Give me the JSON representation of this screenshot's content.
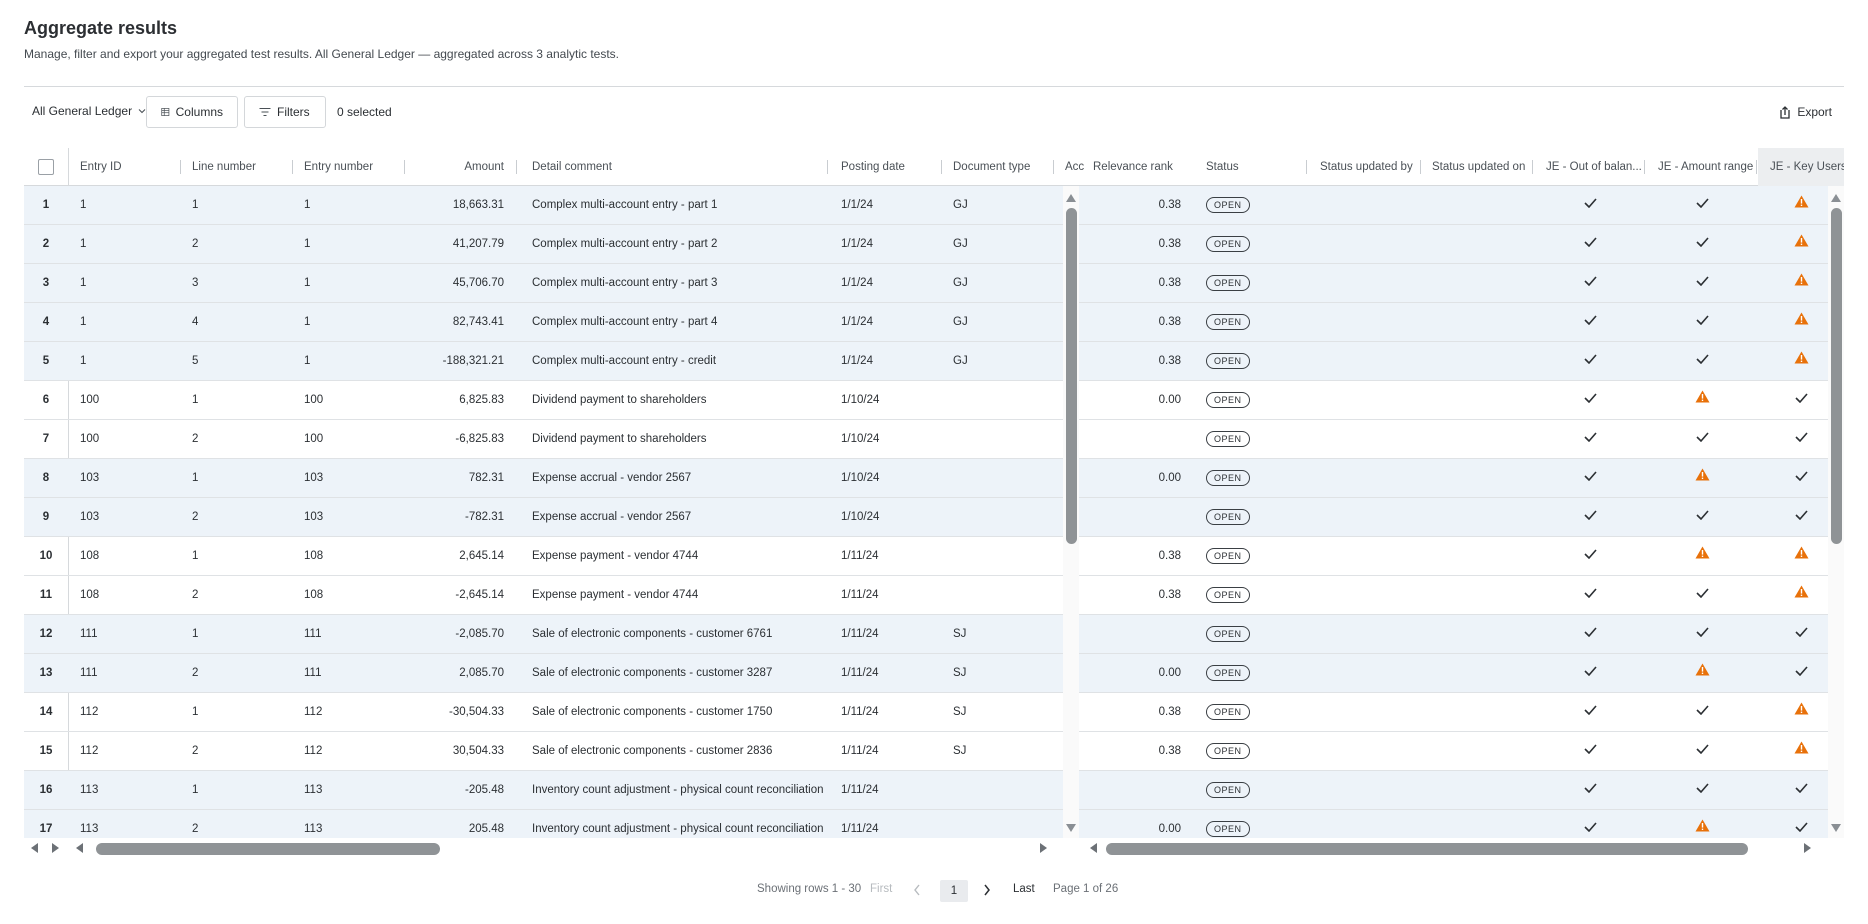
{
  "header": {
    "title": "Aggregate results",
    "subtitle": "Manage, filter and export your aggregated test results. All General Ledger — aggregated across 3 analytic tests."
  },
  "toolbar": {
    "ledger_dropdown": "All General Ledger",
    "columns_label": "Columns",
    "filters_label": "Filters",
    "selected_text": "0 selected",
    "export_label": "Export"
  },
  "columns": {
    "entry_id": "Entry ID",
    "line_number": "Line number",
    "entry_number": "Entry number",
    "amount": "Amount",
    "detail_comment": "Detail comment",
    "posting_date": "Posting date",
    "document_type": "Document type",
    "account": "Acc",
    "relevance_rank": "Relevance rank",
    "status": "Status",
    "status_updated_by": "Status updated by",
    "status_updated_on": "Status updated on",
    "je_out_of_balance": "JE - Out of balan...",
    "je_amount_range": "JE - Amount range",
    "je_key_users": "JE - Key Users"
  },
  "rows": [
    {
      "n": "1",
      "entry_id": "1",
      "line": "1",
      "entry_no": "1",
      "amount": "18,663.31",
      "comment": "Complex multi-account entry - part 1",
      "date": "1/1/24",
      "doc": "GJ",
      "rank": "0.38",
      "status": "OPEN",
      "oob": "check",
      "range": "check",
      "keyusers": "warn",
      "hl": true
    },
    {
      "n": "2",
      "entry_id": "1",
      "line": "2",
      "entry_no": "1",
      "amount": "41,207.79",
      "comment": "Complex multi-account entry - part 2",
      "date": "1/1/24",
      "doc": "GJ",
      "rank": "0.38",
      "status": "OPEN",
      "oob": "check",
      "range": "check",
      "keyusers": "warn",
      "hl": true
    },
    {
      "n": "3",
      "entry_id": "1",
      "line": "3",
      "entry_no": "1",
      "amount": "45,706.70",
      "comment": "Complex multi-account entry - part 3",
      "date": "1/1/24",
      "doc": "GJ",
      "rank": "0.38",
      "status": "OPEN",
      "oob": "check",
      "range": "check",
      "keyusers": "warn",
      "hl": true
    },
    {
      "n": "4",
      "entry_id": "1",
      "line": "4",
      "entry_no": "1",
      "amount": "82,743.41",
      "comment": "Complex multi-account entry - part 4",
      "date": "1/1/24",
      "doc": "GJ",
      "rank": "0.38",
      "status": "OPEN",
      "oob": "check",
      "range": "check",
      "keyusers": "warn",
      "hl": true
    },
    {
      "n": "5",
      "entry_id": "1",
      "line": "5",
      "entry_no": "1",
      "amount": "-188,321.21",
      "comment": "Complex multi-account entry - credit",
      "date": "1/1/24",
      "doc": "GJ",
      "rank": "0.38",
      "status": "OPEN",
      "oob": "check",
      "range": "check",
      "keyusers": "warn",
      "hl": true
    },
    {
      "n": "6",
      "entry_id": "100",
      "line": "1",
      "entry_no": "100",
      "amount": "6,825.83",
      "comment": "Dividend payment to shareholders",
      "date": "1/10/24",
      "doc": "",
      "rank": "0.00",
      "status": "OPEN",
      "oob": "check",
      "range": "warn",
      "keyusers": "check",
      "hl": false
    },
    {
      "n": "7",
      "entry_id": "100",
      "line": "2",
      "entry_no": "100",
      "amount": "-6,825.83",
      "comment": "Dividend payment to shareholders",
      "date": "1/10/24",
      "doc": "",
      "rank": "",
      "status": "OPEN",
      "oob": "check",
      "range": "check",
      "keyusers": "check",
      "hl": false
    },
    {
      "n": "8",
      "entry_id": "103",
      "line": "1",
      "entry_no": "103",
      "amount": "782.31",
      "comment": "Expense accrual - vendor 2567",
      "date": "1/10/24",
      "doc": "",
      "rank": "0.00",
      "status": "OPEN",
      "oob": "check",
      "range": "warn",
      "keyusers": "check",
      "hl": true
    },
    {
      "n": "9",
      "entry_id": "103",
      "line": "2",
      "entry_no": "103",
      "amount": "-782.31",
      "comment": "Expense accrual - vendor 2567",
      "date": "1/10/24",
      "doc": "",
      "rank": "",
      "status": "OPEN",
      "oob": "check",
      "range": "check",
      "keyusers": "check",
      "hl": true
    },
    {
      "n": "10",
      "entry_id": "108",
      "line": "1",
      "entry_no": "108",
      "amount": "2,645.14",
      "comment": "Expense payment - vendor 4744",
      "date": "1/11/24",
      "doc": "",
      "rank": "0.38",
      "status": "OPEN",
      "oob": "check",
      "range": "warn",
      "keyusers": "warn",
      "hl": false
    },
    {
      "n": "11",
      "entry_id": "108",
      "line": "2",
      "entry_no": "108",
      "amount": "-2,645.14",
      "comment": "Expense payment - vendor 4744",
      "date": "1/11/24",
      "doc": "",
      "rank": "0.38",
      "status": "OPEN",
      "oob": "check",
      "range": "check",
      "keyusers": "warn",
      "hl": false
    },
    {
      "n": "12",
      "entry_id": "111",
      "line": "1",
      "entry_no": "111",
      "amount": "-2,085.70",
      "comment": "Sale of electronic components - customer 6761",
      "date": "1/11/24",
      "doc": "SJ",
      "rank": "",
      "status": "OPEN",
      "oob": "check",
      "range": "check",
      "keyusers": "check",
      "hl": true
    },
    {
      "n": "13",
      "entry_id": "111",
      "line": "2",
      "entry_no": "111",
      "amount": "2,085.70",
      "comment": "Sale of electronic components - customer 3287",
      "date": "1/11/24",
      "doc": "SJ",
      "rank": "0.00",
      "status": "OPEN",
      "oob": "check",
      "range": "warn",
      "keyusers": "check",
      "hl": true
    },
    {
      "n": "14",
      "entry_id": "112",
      "line": "1",
      "entry_no": "112",
      "amount": "-30,504.33",
      "comment": "Sale of electronic components - customer 1750",
      "date": "1/11/24",
      "doc": "SJ",
      "rank": "0.38",
      "status": "OPEN",
      "oob": "check",
      "range": "check",
      "keyusers": "warn",
      "hl": false
    },
    {
      "n": "15",
      "entry_id": "112",
      "line": "2",
      "entry_no": "112",
      "amount": "30,504.33",
      "comment": "Sale of electronic components - customer 2836",
      "date": "1/11/24",
      "doc": "SJ",
      "rank": "0.38",
      "status": "OPEN",
      "oob": "check",
      "range": "check",
      "keyusers": "warn",
      "hl": false
    },
    {
      "n": "16",
      "entry_id": "113",
      "line": "1",
      "entry_no": "113",
      "amount": "-205.48",
      "comment": "Inventory count adjustment - physical count reconciliation",
      "date": "1/11/24",
      "doc": "",
      "rank": "",
      "status": "OPEN",
      "oob": "check",
      "range": "check",
      "keyusers": "check",
      "hl": true
    },
    {
      "n": "17",
      "entry_id": "113",
      "line": "2",
      "entry_no": "113",
      "amount": "205.48",
      "comment": "Inventory count adjustment - physical count reconciliation",
      "date": "1/11/24",
      "doc": "",
      "rank": "0.00",
      "status": "OPEN",
      "oob": "check",
      "range": "warn",
      "keyusers": "check",
      "hl": true
    }
  ],
  "pager": {
    "showing": "Showing rows 1 - 30",
    "first": "First",
    "current_page": "1",
    "last": "Last",
    "page_of": "Page 1 of 26"
  },
  "colors": {
    "row_highlight": "#edf3f9",
    "warning": "#e8710a",
    "border": "#d6d9dc"
  },
  "icons": {
    "dropdown": "chevron-down-icon",
    "columns": "columns-icon",
    "filters": "filter-icon",
    "export": "export-icon",
    "check": "check-icon",
    "warn": "warning-triangle-icon"
  }
}
